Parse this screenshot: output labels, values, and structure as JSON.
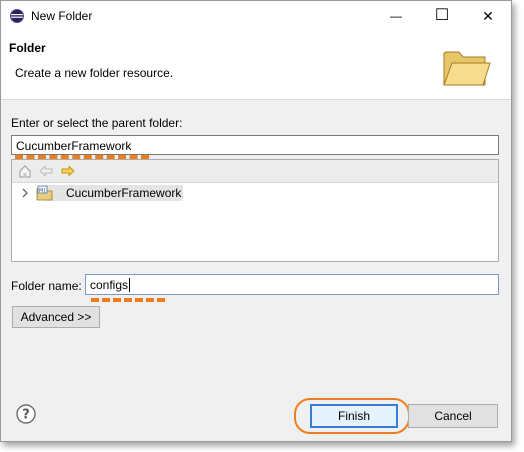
{
  "window": {
    "title": "New Folder",
    "minimize": "—",
    "maximize": "☐",
    "close": "✕"
  },
  "header": {
    "title": "Folder",
    "subtitle": "Create a new folder resource."
  },
  "parent": {
    "label": "Enter or select the parent folder:",
    "value": "CucumberFramework"
  },
  "tree": {
    "items": [
      {
        "label": "CucumberFramework"
      }
    ]
  },
  "folder_name": {
    "label": "Folder name:",
    "value": "configs"
  },
  "buttons": {
    "advanced": "Advanced >>",
    "finish": "Finish",
    "cancel": "Cancel"
  },
  "colors": {
    "annotation": "#ee7d1e",
    "selection": "#e4e4e4",
    "focus_border": "#3b7bd4"
  },
  "icons": [
    "eclipse-app-icon",
    "folder-icon",
    "home-icon",
    "back-arrow-icon",
    "forward-arrow-icon",
    "chevron-right-icon",
    "java-project-icon",
    "help-icon"
  ]
}
